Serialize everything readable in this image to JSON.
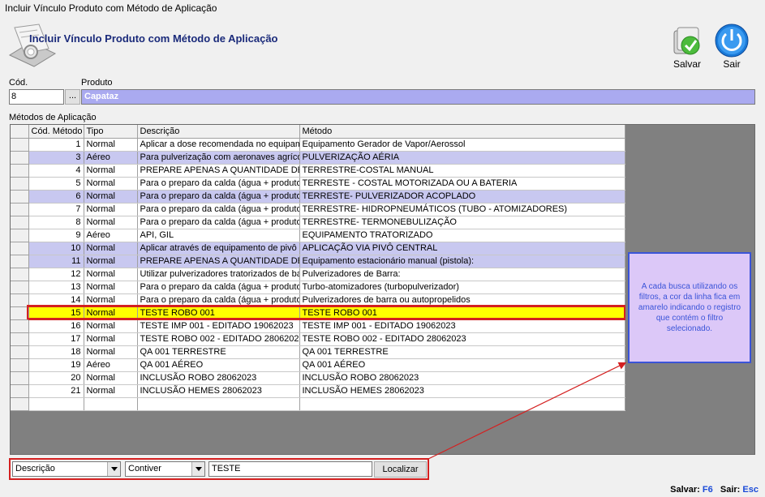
{
  "window": {
    "title": "Incluir Vínculo Produto com Método de Aplicação"
  },
  "header": {
    "title": "Incluir Vínculo Produto com Método de Aplicação"
  },
  "toolbar": {
    "save_label": "Salvar",
    "exit_label": "Sair"
  },
  "form": {
    "cod_label": "Cód.",
    "cod_value": "8",
    "dots_label": "...",
    "produto_label": "Produto",
    "produto_value": "Capataz"
  },
  "grid": {
    "section_label": "Métodos de Aplicação",
    "columns": [
      "Cód. Método",
      "Tipo",
      "Descrição",
      "Método"
    ],
    "rows": [
      {
        "cod": "1",
        "tipo": "Normal",
        "desc": " Aplicar a dose recomendada no equipamento",
        "metodo": "Equipamento Gerador de Vapor/Aerossol",
        "style": ""
      },
      {
        "cod": "3",
        "tipo": "Aéreo",
        "desc": "Para pulverização com aeronaves agrícolas",
        "metodo": "PULVERIZAÇÃO AÉRIA",
        "style": "alt"
      },
      {
        "cod": "4",
        "tipo": "Normal",
        "desc": "PREPARE APENAS A QUANTIDADE DE",
        "metodo": "TERRESTRE-COSTAL MANUAL",
        "style": ""
      },
      {
        "cod": "5",
        "tipo": "Normal",
        "desc": "Para o preparo da calda (água + produto)",
        "metodo": "TERRESTE - COSTAL MOTORIZADA OU A BATERIA",
        "style": ""
      },
      {
        "cod": "6",
        "tipo": "Normal",
        "desc": "Para o preparo da calda (água + produto)",
        "metodo": "TERRESTE- PULVERIZADOR ACOPLADO",
        "style": "alt"
      },
      {
        "cod": "7",
        "tipo": "Normal",
        "desc": "Para o preparo da calda (água + produto)",
        "metodo": "TERRESTRE- HIDROPNEUMÁTICOS (TUBO - ATOMIZADORES)",
        "style": ""
      },
      {
        "cod": "8",
        "tipo": "Normal",
        "desc": "Para o preparo da calda (água + produto)",
        "metodo": "TERRESTRE- TERMONEBULIZAÇÃO",
        "style": ""
      },
      {
        "cod": "9",
        "tipo": "Aéreo",
        "desc": "API, GIL",
        "metodo": "EQUIPAMENTO TRATORIZADO",
        "style": ""
      },
      {
        "cod": "10",
        "tipo": "Normal",
        "desc": "Aplicar através de equipamento de pivô c",
        "metodo": "APLICAÇÃO VIA PIVÔ CENTRAL",
        "style": "alt"
      },
      {
        "cod": "11",
        "tipo": "Normal",
        "desc": "PREPARE APENAS A QUANTIDADE DE",
        "metodo": "Equipamento estacionário manual (pistola):",
        "style": "alt"
      },
      {
        "cod": "12",
        "tipo": "Normal",
        "desc": "Utilizar pulverizadores tratorizados de barra",
        "metodo": "Pulverizadores de Barra:",
        "style": ""
      },
      {
        "cod": "13",
        "tipo": "Normal",
        "desc": "Para o preparo da calda (água + produto)",
        "metodo": "Turbo-atomizadores (turbopulverizador)",
        "style": ""
      },
      {
        "cod": "14",
        "tipo": "Normal",
        "desc": "Para o preparo da calda (água + produto)",
        "metodo": "Pulverizadores de barra ou autopropelidos",
        "style": ""
      },
      {
        "cod": "15",
        "tipo": "Normal",
        "desc": "TESTE ROBO 001",
        "metodo": "TESTE ROBO 001",
        "style": "hl"
      },
      {
        "cod": "16",
        "tipo": "Normal",
        "desc": "TESTE IMP 001 - EDITADO 19062023",
        "metodo": "TESTE IMP 001 - EDITADO 19062023",
        "style": ""
      },
      {
        "cod": "17",
        "tipo": "Normal",
        "desc": "TESTE ROBO 002 - EDITADO 28062023",
        "metodo": "TESTE ROBO 002 - EDITADO 28062023",
        "style": ""
      },
      {
        "cod": "18",
        "tipo": "Normal",
        "desc": "QA 001 TERRESTRE",
        "metodo": "QA 001 TERRESTRE",
        "style": ""
      },
      {
        "cod": "19",
        "tipo": "Aéreo",
        "desc": "QA 001 AÉREO",
        "metodo": "QA 001 AÉREO",
        "style": ""
      },
      {
        "cod": "20",
        "tipo": "Normal",
        "desc": "INCLUSÃO ROBO 28062023",
        "metodo": "INCLUSÃO ROBO 28062023",
        "style": ""
      },
      {
        "cod": "21",
        "tipo": "Normal",
        "desc": "INCLUSÃO HEMES 28062023",
        "metodo": "INCLUSÃO HEMES 28062023",
        "style": ""
      },
      {
        "cod": "",
        "tipo": "",
        "desc": "",
        "metodo": "",
        "style": ""
      }
    ]
  },
  "note": {
    "text": "A cada busca utilizando os filtros, a cor da linha fica em amarelo indicando o registro que contém o filtro selecionado."
  },
  "search": {
    "field_value": "Descrição",
    "operator_value": "Contiver",
    "term_value": "TESTE",
    "find_label": "Localizar"
  },
  "status": {
    "save_text": "Salvar:",
    "save_key": "F6",
    "exit_text": "Sair:",
    "exit_key": "Esc"
  },
  "colors": {
    "highlight_row": "#ffff00",
    "alt_row": "#c8c8f0",
    "annotation_red": "#d42020",
    "note_bg": "#dcc8f8",
    "note_border": "#3a54d8"
  }
}
